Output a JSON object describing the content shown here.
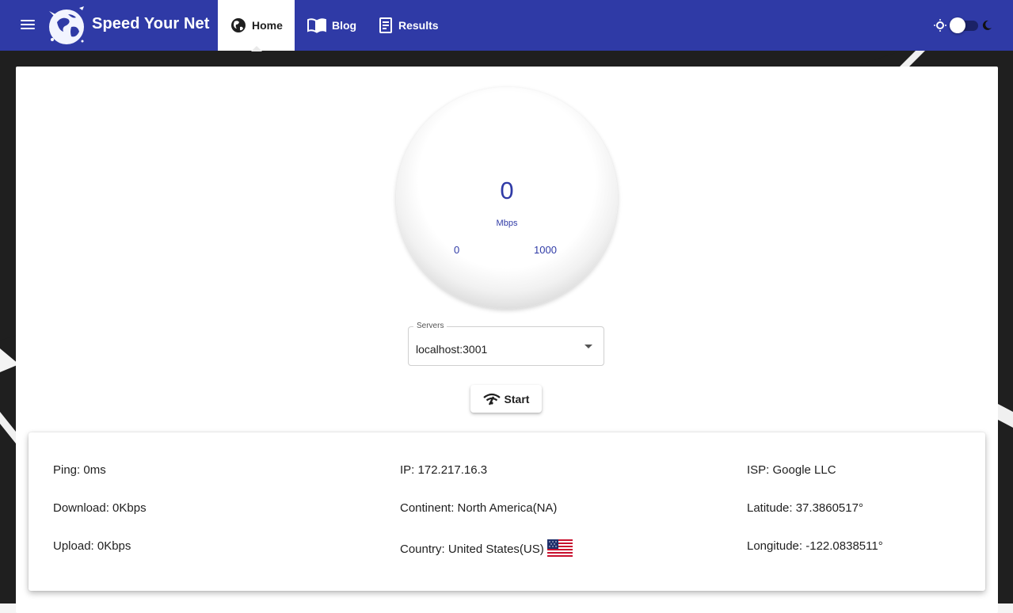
{
  "app": {
    "brand": "Speed Your Net",
    "accent_color": "#2f3aa6"
  },
  "nav": {
    "tabs": [
      {
        "label": "Home",
        "icon": "globe-icon",
        "active": true
      },
      {
        "label": "Blog",
        "icon": "book-icon",
        "active": false
      },
      {
        "label": "Results",
        "icon": "receipt-icon",
        "active": false
      }
    ],
    "theme_toggle": {
      "light_icon": "sun-icon",
      "dark_icon": "moon-icon",
      "dark_mode": false
    }
  },
  "gauge": {
    "value": "0",
    "unit": "Mbps",
    "min": "0",
    "max": "1000"
  },
  "servers": {
    "label": "Servers",
    "selected": "localhost:3001"
  },
  "start_button": {
    "label": "Start",
    "icon": "wifi-icon"
  },
  "info": {
    "ping": "Ping: 0ms",
    "download": "Download: 0Kbps",
    "upload": "Upload: 0Kbps",
    "ip": "IP: 172.217.16.3",
    "continent": "Continent: North America(NA)",
    "country": "Country: United States(US)",
    "country_flag_icon": "us-flag-icon",
    "isp": "ISP: Google LLC",
    "latitude": "Latitude: 37.3860517°",
    "longitude": "Longitude: -122.0838511°"
  }
}
